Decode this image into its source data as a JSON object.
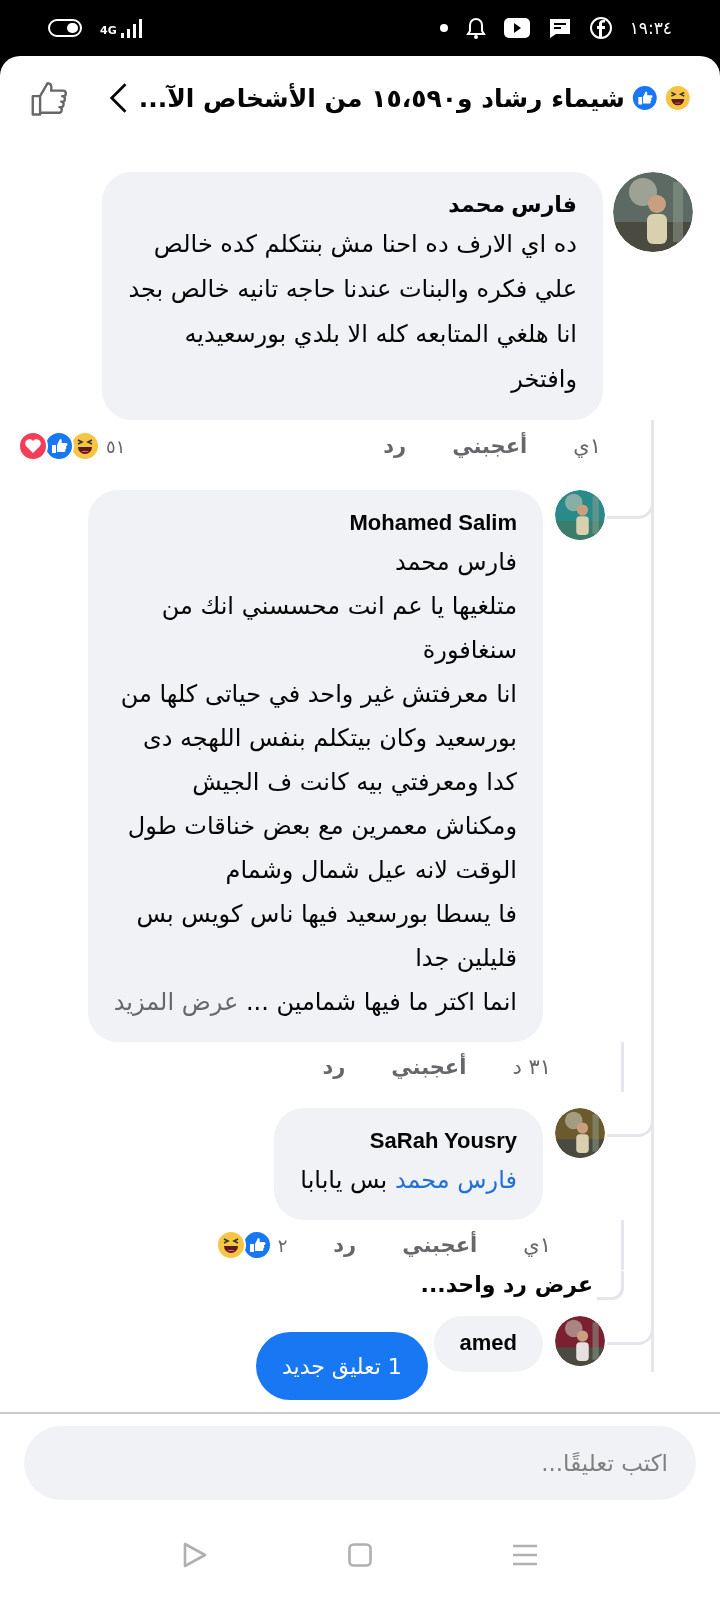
{
  "status_bar": {
    "time": "١٩:٣٤",
    "network": "4G"
  },
  "header": {
    "title": "شيماء رشاد و١٥،٥٩٠ من الأشخاص الآ..."
  },
  "comments": [
    {
      "author": "فارس محمد",
      "body": "ده اي الارف ده احنا مش بنتكلم كده خالص\nعلي فكره والبنات عندنا حاجه تانيه خالص بجد\nانا هلغي المتابعه كله الا بلدي بورسعيديه\nوافتخر",
      "time": "١ي",
      "like": "أعجبني",
      "reply": "رد",
      "reaction_count": "٥١",
      "reactions": [
        {
          "kind": "haha"
        },
        {
          "kind": "like"
        },
        {
          "kind": "love"
        }
      ],
      "replies": [
        {
          "author": "Mohamed Salim",
          "body": "فارس محمد\nمتلغيها يا عم انت محسسني انك من\nسنغافورة\nانا معرفتش غير واحد في حياتى كلها من\nبورسعيد وكان بيتكلم بنفس اللهجه دى\nكدا ومعرفتي بيه كانت ف الجيش\nومكناش معمرين مع بعض خناقات طول\nالوقت لانه عيل شمال وشمام\nفا يسطا بورسعيد فيها ناس كويس بس\nقليلين جدا\nانما اكتر ما فيها شمامين ...",
          "see_more": "عرض المزيد",
          "time": "٣١ د",
          "like": "أعجبني",
          "reply": "رد"
        },
        {
          "author": "SaRah Yousry",
          "mention": "فارس محمد",
          "body": "بس يابابا",
          "time": "١ي",
          "like": "أعجبني",
          "reply": "رد",
          "reaction_count": "٢",
          "reactions": [
            {
              "kind": "like"
            },
            {
              "kind": "haha"
            }
          ],
          "view_replies": "عرض رد واحد..."
        },
        {
          "author": "amed"
        }
      ]
    }
  ],
  "new_comments_button": "1 تعليق جديد",
  "composer": {
    "placeholder": "اكتب تعليقًا..."
  }
}
